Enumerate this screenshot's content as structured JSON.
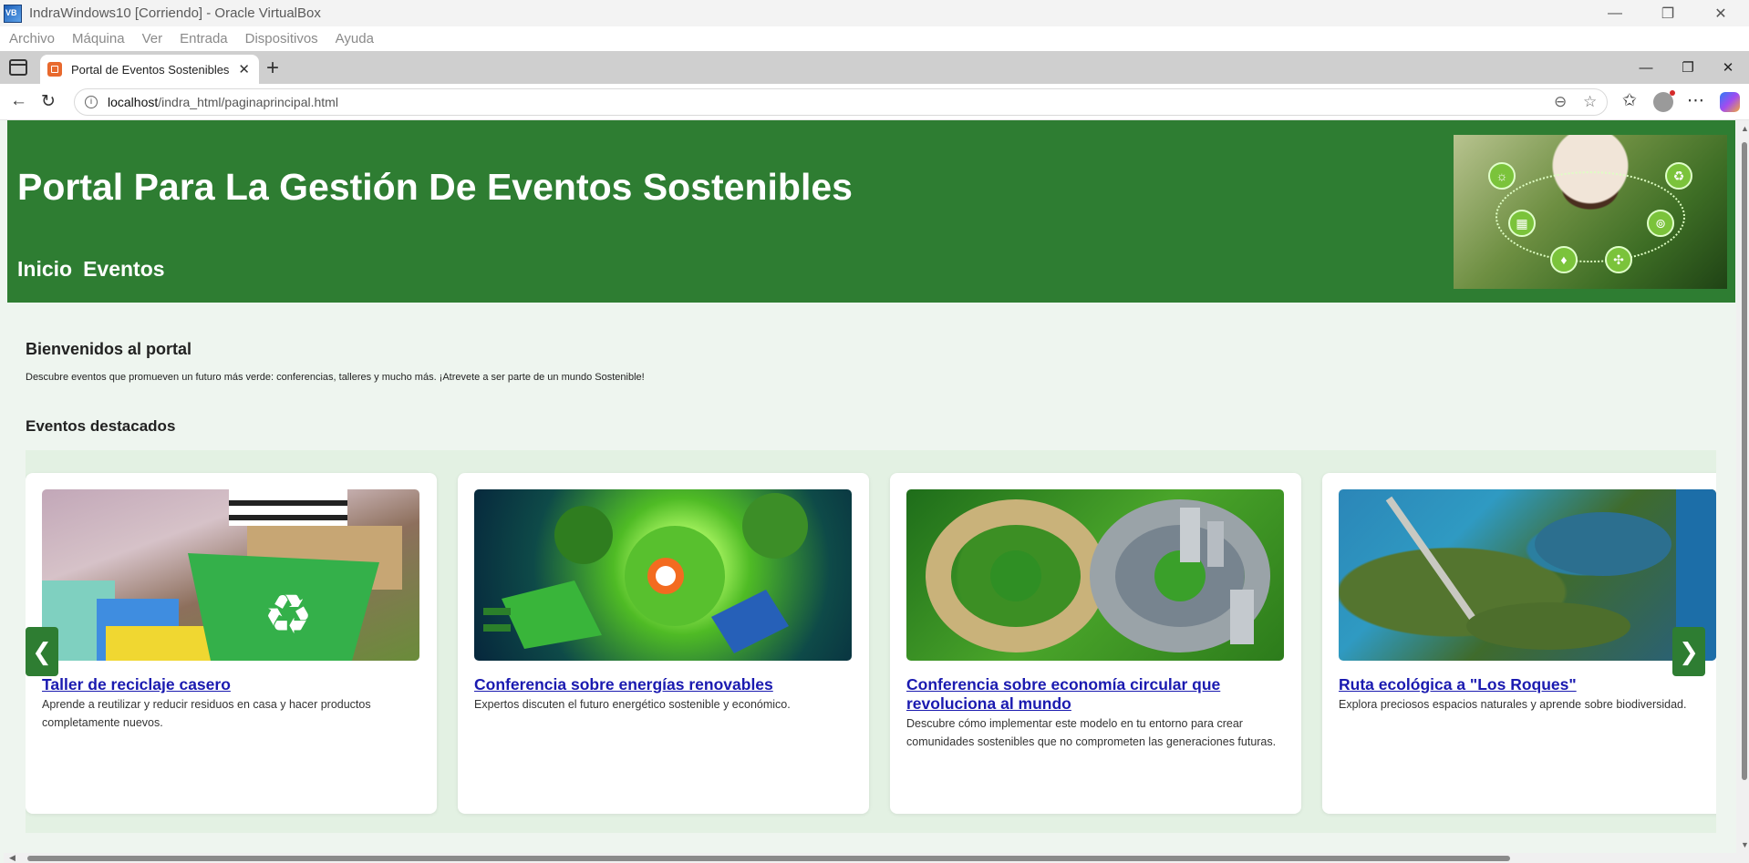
{
  "vbox": {
    "title": "IndraWindows10 [Corriendo] - Oracle VirtualBox",
    "menu": [
      "Archivo",
      "Máquina",
      "Ver",
      "Entrada",
      "Dispositivos",
      "Ayuda"
    ]
  },
  "browser": {
    "tab_title": "Portal de Eventos Sostenibles",
    "url_host": "localhost",
    "url_path": "/indra_html/paginaprincipal.html"
  },
  "site": {
    "title": "Portal Para La Gestión De Eventos Sostenibles",
    "nav": [
      "Inicio",
      "Eventos"
    ],
    "accent_color": "#2e7d32"
  },
  "welcome": {
    "heading": "Bienvenidos al portal",
    "text": "Descubre eventos que promueven un futuro más verde: conferencias, talleres y mucho más. ¡Atrevete a ser parte de un mundo Sostenible!"
  },
  "featured": {
    "heading": "Eventos destacados",
    "prev_label": "❮",
    "next_label": "❯",
    "cards": [
      {
        "title": "Taller de reciclaje casero",
        "description": "Aprende a reutilizar y reducir residuos en casa y hacer productos completamente nuevos."
      },
      {
        "title": "Conferencia sobre energías renovables",
        "description": "Expertos discuten el futuro energético sostenible y económico."
      },
      {
        "title": "Conferencia sobre economía circular que revoluciona al mundo",
        "description": "Descubre cómo implementar este modelo en tu entorno para crear comunidades sostenibles que no comprometen las generaciones futuras."
      },
      {
        "title": "Ruta ecológica a \"Los Roques\"",
        "description": "Explora preciosos espacios naturales y aprende sobre biodiversidad."
      }
    ]
  }
}
